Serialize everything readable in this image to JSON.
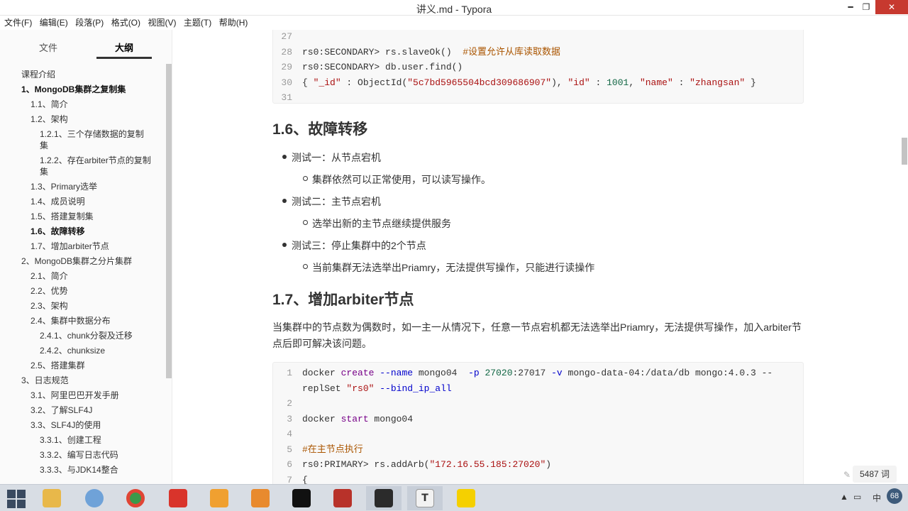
{
  "window": {
    "title": "讲义.md - Typora",
    "min_glyph": "━",
    "max_glyph": "❐",
    "close_glyph": "✕"
  },
  "menu": [
    "文件(F)",
    "编辑(E)",
    "段落(P)",
    "格式(O)",
    "视图(V)",
    "主题(T)",
    "帮助(H)"
  ],
  "sidebar": {
    "tab_files": "文件",
    "tab_outline": "大纲",
    "footer_back": "‹",
    "footer_code": "</>",
    "items": [
      {
        "label": "课程介绍",
        "level": 1
      },
      {
        "label": "1、MongoDB集群之复制集",
        "level": 1,
        "bold": true
      },
      {
        "label": "1.1、简介",
        "level": 2
      },
      {
        "label": "1.2、架构",
        "level": 2
      },
      {
        "label": "1.2.1、三个存储数据的复制集",
        "level": 3
      },
      {
        "label": "1.2.2、存在arbiter节点的复制集",
        "level": 3
      },
      {
        "label": "1.3、Primary选举",
        "level": 2
      },
      {
        "label": "1.4、成员说明",
        "level": 2
      },
      {
        "label": "1.5、搭建复制集",
        "level": 2
      },
      {
        "label": "1.6、故障转移",
        "level": 2,
        "bold": true
      },
      {
        "label": "1.7、增加arbiter节点",
        "level": 2
      },
      {
        "label": "2、MongoDB集群之分片集群",
        "level": 1
      },
      {
        "label": "2.1、简介",
        "level": 2
      },
      {
        "label": "2.2、优势",
        "level": 2
      },
      {
        "label": "2.3、架构",
        "level": 2
      },
      {
        "label": "2.4、集群中数据分布",
        "level": 2
      },
      {
        "label": "2.4.1、chunk分裂及迁移",
        "level": 3
      },
      {
        "label": "2.4.2、chunksize",
        "level": 3
      },
      {
        "label": "2.5、搭建集群",
        "level": 2
      },
      {
        "label": "3、日志规范",
        "level": 1
      },
      {
        "label": "3.1、阿里巴巴开发手册",
        "level": 2
      },
      {
        "label": "3.2、了解SLF4J",
        "level": 2
      },
      {
        "label": "3.3、SLF4J的使用",
        "level": 2
      },
      {
        "label": "3.3.1、创建工程",
        "level": 3
      },
      {
        "label": "3.3.2、编写日志代码",
        "level": 3
      },
      {
        "label": "3.3.3、与JDK14整合",
        "level": 3
      }
    ]
  },
  "doc": {
    "code1": {
      "lines": [
        {
          "n": "27",
          "text": ""
        },
        {
          "n": "28",
          "text": "rs0:SECONDARY> rs.slaveOk()  ",
          "comment": "#设置允许从库读取数据"
        },
        {
          "n": "29",
          "text": "rs0:SECONDARY> db.user.find()"
        },
        {
          "n": "30",
          "text": "{ \"_id\" : ObjectId(\"5c7bd5965504bcd309686907\"), \"id\" : 1001, \"name\" : \"zhangsan\" }"
        },
        {
          "n": "31",
          "text": ""
        }
      ]
    },
    "h_failover": "1.6、故障转移",
    "bullets": [
      {
        "text": "测试一：从节点宕机",
        "level": 1
      },
      {
        "text": "集群依然可以正常使用，可以读写操作。",
        "level": 2
      },
      {
        "text": "测试二：主节点宕机",
        "level": 1
      },
      {
        "text": "选举出新的主节点继续提供服务",
        "level": 2
      },
      {
        "text": "测试三：停止集群中的2个节点",
        "level": 1
      },
      {
        "text": "当前集群无法选举出Priamry，无法提供写操作，只能进行读操作",
        "level": 2
      }
    ],
    "h_arbiter": "1.7、增加arbiter节点",
    "para": "当集群中的节点数为偶数时，如一主一从情况下，任意一节点宕机都无法选举出Priamry，无法提供写操作，加入arbiter节点后即可解决该问题。",
    "code2": {
      "lines": [
        {
          "n": "1",
          "text": "docker create --name mongo04  -p 27020:27017 -v mongo-data-04:/data/db mongo:4.0.3 --"
        },
        {
          "n": "",
          "text": "replSet \"rs0\" --bind_ip_all"
        },
        {
          "n": "2",
          "text": ""
        },
        {
          "n": "3",
          "text": "docker start mongo04"
        },
        {
          "n": "4",
          "text": ""
        },
        {
          "n": "5",
          "text": "",
          "comment": "#在主节点执行"
        },
        {
          "n": "6",
          "text": "rs0:PRIMARY> rs.addArb(\"172.16.55.185:27020\")"
        },
        {
          "n": "7",
          "text": "{"
        }
      ]
    }
  },
  "status": {
    "word_count": "5487 词",
    "brush_glyph": "✎"
  },
  "tray": {
    "up_arrow": "▲",
    "ime": "中",
    "badge": "68"
  }
}
